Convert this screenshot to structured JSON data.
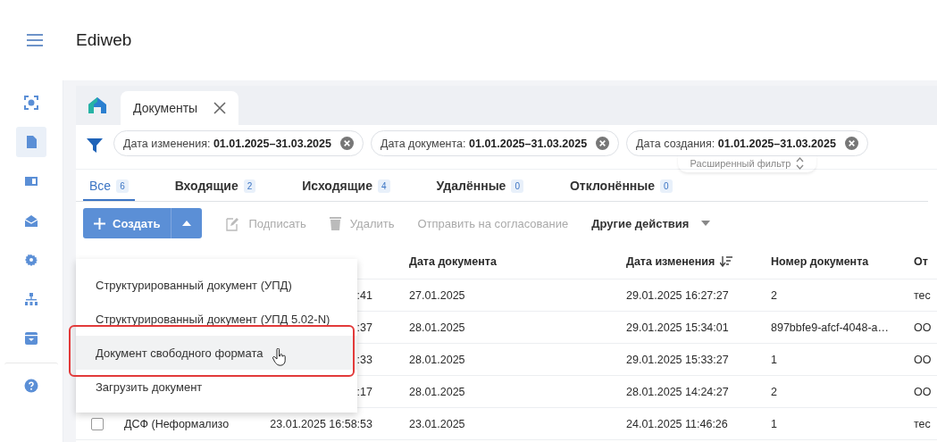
{
  "header": {
    "title": "Ediweb"
  },
  "sidebar": {
    "items": [
      {
        "selected": false
      },
      {
        "selected": true
      },
      {
        "selected": false
      },
      {
        "selected": false
      },
      {
        "selected": false
      },
      {
        "selected": false
      },
      {
        "selected": false
      },
      {
        "selected": false
      }
    ]
  },
  "tabs": [
    {
      "label": "Документы",
      "selected": true
    }
  ],
  "filters": {
    "chips": [
      {
        "text": "Дата изменения: **01.01.2025–31.03.2025**"
      },
      {
        "text": "Дата документа: **01.01.2025–31.03.2025**"
      },
      {
        "text": "Дата создания: **01.01.2025–31.03.2025**"
      }
    ],
    "advanced_filter": "Расширенный фильтр"
  },
  "status_tabs": [
    {
      "label": "Все",
      "count": "6",
      "selected": true
    },
    {
      "label": "Входящие",
      "count": "2",
      "selected": false
    },
    {
      "label": "Исходящие",
      "count": "4",
      "selected": false
    },
    {
      "label": "Удалённые",
      "count": "0",
      "selected": false
    },
    {
      "label": "Отклонённые",
      "count": "0",
      "selected": false
    }
  ],
  "toolbar": {
    "create": {
      "label": "Создать",
      "menu_open": true
    },
    "actions": [
      {
        "kind": "sign",
        "label": "Подписать",
        "disabled": true
      },
      {
        "kind": "delete",
        "label": "Удалить",
        "disabled": true
      },
      {
        "kind": "plain",
        "label": "Отправить на согласование",
        "disabled": true
      },
      {
        "kind": "menu",
        "label": "Другие действия",
        "disabled": false
      }
    ]
  },
  "create_menu": {
    "items": [
      {
        "label": "Структурированный документ (УПД)",
        "highlighted": false,
        "outlined": false
      },
      {
        "label": "Структурированный документ (УПД 5.02-N)",
        "highlighted": false,
        "outlined": false
      },
      {
        "label": "Документ свободного формата",
        "highlighted": true,
        "outlined": true
      },
      {
        "label": "Загрузить документ",
        "highlighted": false,
        "outlined": false
      }
    ]
  },
  "table": {
    "columns": [
      {
        "label": "Дата документа",
        "sorted": false
      },
      {
        "label": "Дата изменения",
        "sorted": true
      },
      {
        "label": "Номер документа",
        "sorted": false
      },
      {
        "label": "От",
        "sorted": false
      }
    ],
    "rows": [
      {
        "column_3": ":41",
        "cells": [
          "27.01.2025",
          "29.01.2025 16:27:27",
          "2",
          "тес"
        ]
      },
      {
        "column_3": ":37",
        "cells": [
          "28.01.2025",
          "29.01.2025 15:34:01",
          "897bbfe9-afcf-4048-a…",
          "ОО"
        ]
      },
      {
        "column_3": ":33",
        "cells": [
          "28.01.2025",
          "29.01.2025 15:33:27",
          "1",
          "ОО"
        ]
      },
      {
        "column_3": ":17",
        "cells": [
          "28.01.2025",
          "28.01.2025 14:24:27",
          "2",
          "ОО"
        ]
      },
      {
        "checked": false,
        "column_2": "ДСФ (Неформализо",
        "column_3": "23.01.2025 16:58:53",
        "cells": [
          "23.01.2025",
          "24.01.2025 11:46:26",
          "1",
          "тес"
        ]
      }
    ]
  }
}
